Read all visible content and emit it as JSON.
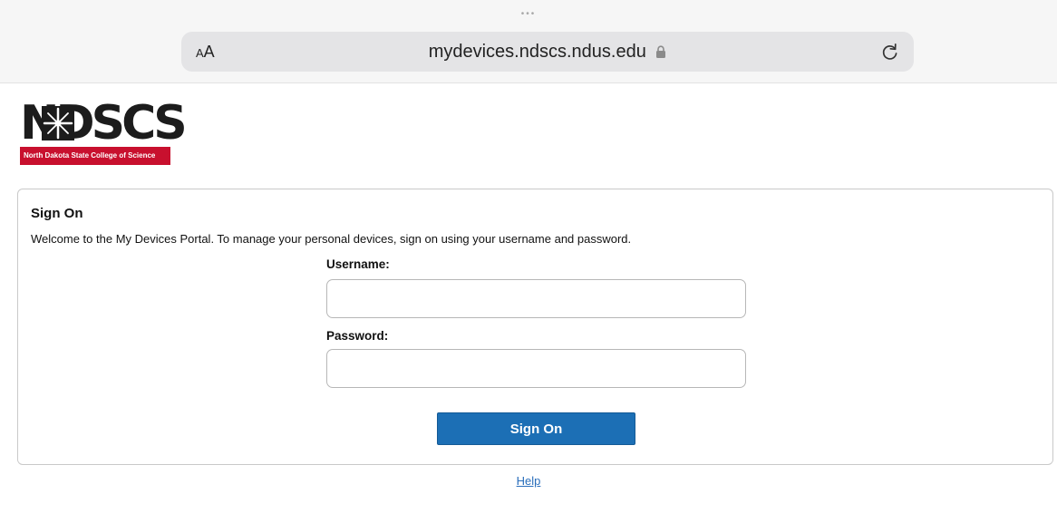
{
  "browser": {
    "tab_indicator": "•••",
    "text_size_label_small": "A",
    "text_size_label_large": "A",
    "url": "mydevices.ndscs.ndus.edu",
    "lock_icon": "lock-icon",
    "reload_icon": "reload-icon"
  },
  "logo": {
    "wordmark": "NDSCS",
    "tagline": "North Dakota State College of Science",
    "band_color": "#c8102e"
  },
  "sign_on": {
    "title": "Sign On",
    "welcome": "Welcome to the My Devices Portal. To manage your personal devices, sign on using your username and password.",
    "username_label": "Username:",
    "username_value": "",
    "password_label": "Password:",
    "password_value": "",
    "button_label": "Sign On",
    "button_color": "#1c6fb5"
  },
  "footer": {
    "help_label": "Help"
  }
}
